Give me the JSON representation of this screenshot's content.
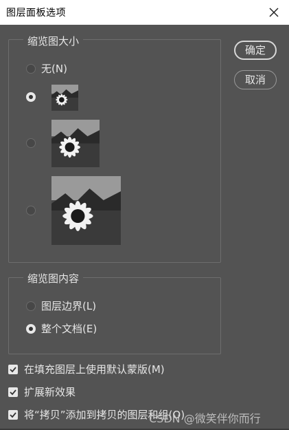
{
  "dialog": {
    "title": "图层面板选项"
  },
  "buttons": {
    "ok": "确定",
    "cancel": "取消"
  },
  "thumbnail_size": {
    "legend": "缩览图大小",
    "options": [
      {
        "label": "无(N)",
        "checked": false
      },
      {
        "label": "",
        "checked": true,
        "preview": "small"
      },
      {
        "label": "",
        "checked": false,
        "preview": "medium"
      },
      {
        "label": "",
        "checked": false,
        "preview": "large"
      }
    ]
  },
  "thumbnail_contents": {
    "legend": "缩览图内容",
    "options": [
      {
        "label": "图层边界(L)",
        "checked": false
      },
      {
        "label": "整个文档(E)",
        "checked": true
      }
    ]
  },
  "checkboxes": [
    {
      "label": "在填充图层上使用默认蒙版(M)",
      "checked": true
    },
    {
      "label": "扩展新效果",
      "checked": true
    },
    {
      "label": "将“拷贝”添加到拷贝的图层和组(O)",
      "checked": true
    }
  ],
  "watermark": "CSDN @微笑伴你而行",
  "icons": {
    "close": "close-icon",
    "checkmark": "checkmark-icon",
    "preview": "sunflower-preview-image"
  }
}
